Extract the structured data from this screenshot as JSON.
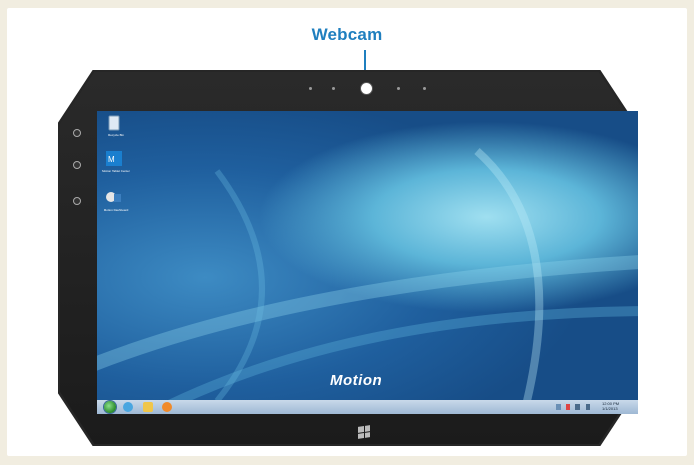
{
  "callout": {
    "label": "Webcam"
  },
  "device": {
    "brand": "Motion"
  },
  "desktop": {
    "icons": [
      {
        "name": "recycle-bin-icon",
        "label": "Recycle Bin"
      },
      {
        "name": "motion-app-icon",
        "label": "Motion Tablet Center"
      },
      {
        "name": "shortcut-icon",
        "label": "Motion Dashboard"
      }
    ]
  },
  "taskbar": {
    "clock_time": "12:00 PM",
    "clock_date": "1/1/2013"
  },
  "colors": {
    "accent": "#1f7fbf",
    "background": "#f1ede0",
    "bezel": "#262626"
  }
}
